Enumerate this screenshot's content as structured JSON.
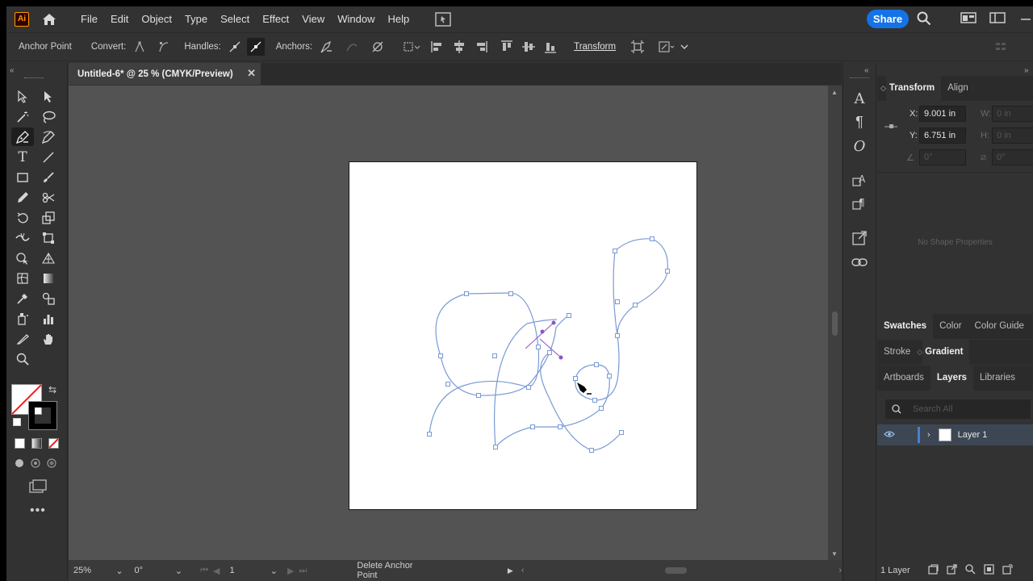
{
  "app": {
    "logo": "Ai"
  },
  "menu": [
    "File",
    "Edit",
    "Object",
    "Type",
    "Select",
    "Effect",
    "View",
    "Window",
    "Help"
  ],
  "share_label": "Share",
  "controlbar": {
    "tool_label": "Anchor Point",
    "convert_label": "Convert:",
    "handles_label": "Handles:",
    "anchors_label": "Anchors:",
    "transform_label": "Transform"
  },
  "document": {
    "tab_title": "Untitled-6* @ 25 % (CMYK/Preview)"
  },
  "status": {
    "zoom": "25%",
    "rotation": "0°",
    "artboard_number": "1",
    "current_tool": "Delete Anchor Point"
  },
  "transform_panel": {
    "tabs": [
      "Transform",
      "Align"
    ],
    "x_label": "X:",
    "x_value": "9.001 in",
    "y_label": "Y:",
    "y_value": "6.751 in",
    "w_label": "W:",
    "w_value": "0 in",
    "h_label": "H:",
    "h_value": "0 in",
    "angle_value": "0°",
    "shear_value": "0°",
    "empty_text": "No Shape Properties"
  },
  "swatch_tabs": [
    "Swatches",
    "Color",
    "Color Guide"
  ],
  "stroke_tabs": [
    "Stroke",
    "Gradient"
  ],
  "layers_tabs": [
    "Artboards",
    "Layers",
    "Libraries"
  ],
  "layers": {
    "search_placeholder": "Search All",
    "items": [
      {
        "name": "Layer 1"
      }
    ],
    "count_label": "1 Layer"
  },
  "colors": {
    "path": "#7a9ad4",
    "selected_anchor": "#8a55c8",
    "share": "#1473e6",
    "ai_logo": "#ff9a00"
  }
}
